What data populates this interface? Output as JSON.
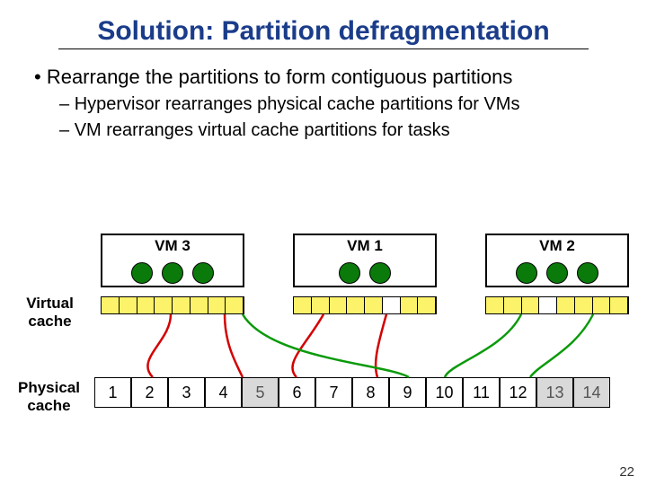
{
  "title": "Solution: Partition defragmentation",
  "bullets": {
    "main": "Rearrange the partitions to form contiguous partitions",
    "sub1": "Hypervisor rearranges physical cache partitions for VMs",
    "sub2": "VM rearranges virtual cache partitions for tasks"
  },
  "vm_labels": {
    "vm3": "VM 3",
    "vm1": "VM 1",
    "vm2": "VM 2"
  },
  "side_labels": {
    "virtual": "Virtual cache",
    "physical": "Physical cache"
  },
  "physical_cells": [
    "1",
    "2",
    "3",
    "4",
    "5",
    "6",
    "7",
    "8",
    "9",
    "10",
    "11",
    "12",
    "13",
    "14"
  ],
  "page_number": "22",
  "chart_data": {
    "type": "table",
    "vms": [
      {
        "name": "VM 3",
        "tasks": 3,
        "virtual_slots": 8,
        "used_slots": 8
      },
      {
        "name": "VM 1",
        "tasks": 2,
        "virtual_slots": 8,
        "used_slots": 7
      },
      {
        "name": "VM 2",
        "tasks": 3,
        "virtual_slots": 8,
        "used_slots": 7
      }
    ],
    "physical_cache_slots": 14,
    "active_physical_slots": [
      1,
      2,
      3,
      4,
      6,
      7,
      8,
      9,
      10,
      11,
      12
    ],
    "gray_physical_slots": [
      5,
      13,
      14
    ],
    "mapping_arrows": [
      {
        "from": "VM3-virtual",
        "to_slot_range": [
          1,
          4
        ],
        "color": "red"
      },
      {
        "from": "VM1-virtual",
        "to_slot_range": [
          6,
          8
        ],
        "color": "red"
      },
      {
        "from": "VM3-virtual-extra",
        "to_slot": 9,
        "color": "green"
      },
      {
        "from": "VM2-virtual",
        "to_slot_range": [
          10,
          12
        ],
        "color": "green"
      }
    ]
  }
}
